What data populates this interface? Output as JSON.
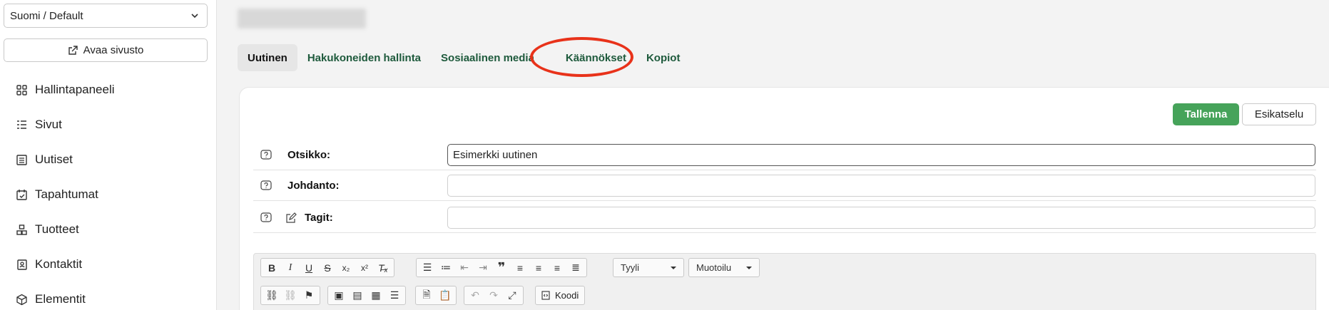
{
  "sidebar": {
    "language_select": "Suomi / Default",
    "open_site_label": "Avaa sivusto",
    "items": [
      {
        "label": "Hallintapaneeli",
        "icon": "dashboard-icon"
      },
      {
        "label": "Sivut",
        "icon": "pages-icon"
      },
      {
        "label": "Uutiset",
        "icon": "news-icon"
      },
      {
        "label": "Tapahtumat",
        "icon": "calendar-icon"
      },
      {
        "label": "Tuotteet",
        "icon": "products-icon"
      },
      {
        "label": "Kontaktit",
        "icon": "contacts-icon"
      },
      {
        "label": "Elementit",
        "icon": "cube-icon"
      }
    ]
  },
  "main": {
    "tabs": [
      {
        "label": "Uutinen",
        "active": true
      },
      {
        "label": "Hakukoneiden hallinta"
      },
      {
        "label": "Sosiaalinen media"
      },
      {
        "label": "Käännökset",
        "highlighted": true
      },
      {
        "label": "Kopiot"
      }
    ],
    "save_label": "Tallenna",
    "preview_label": "Esikatselu",
    "fields": [
      {
        "label": "Otsikko:",
        "value": "Esimerkki uutinen"
      },
      {
        "label": "Johdanto:",
        "value": ""
      },
      {
        "label": "Tagit:",
        "value": ""
      }
    ],
    "editor": {
      "style_select": "Tyyli",
      "format_select": "Muotoilu",
      "code_label": "Koodi"
    }
  },
  "colors": {
    "accent_green": "#46a35a",
    "tab_text": "#1e5a3c",
    "highlight_circle": "#e8321a"
  }
}
